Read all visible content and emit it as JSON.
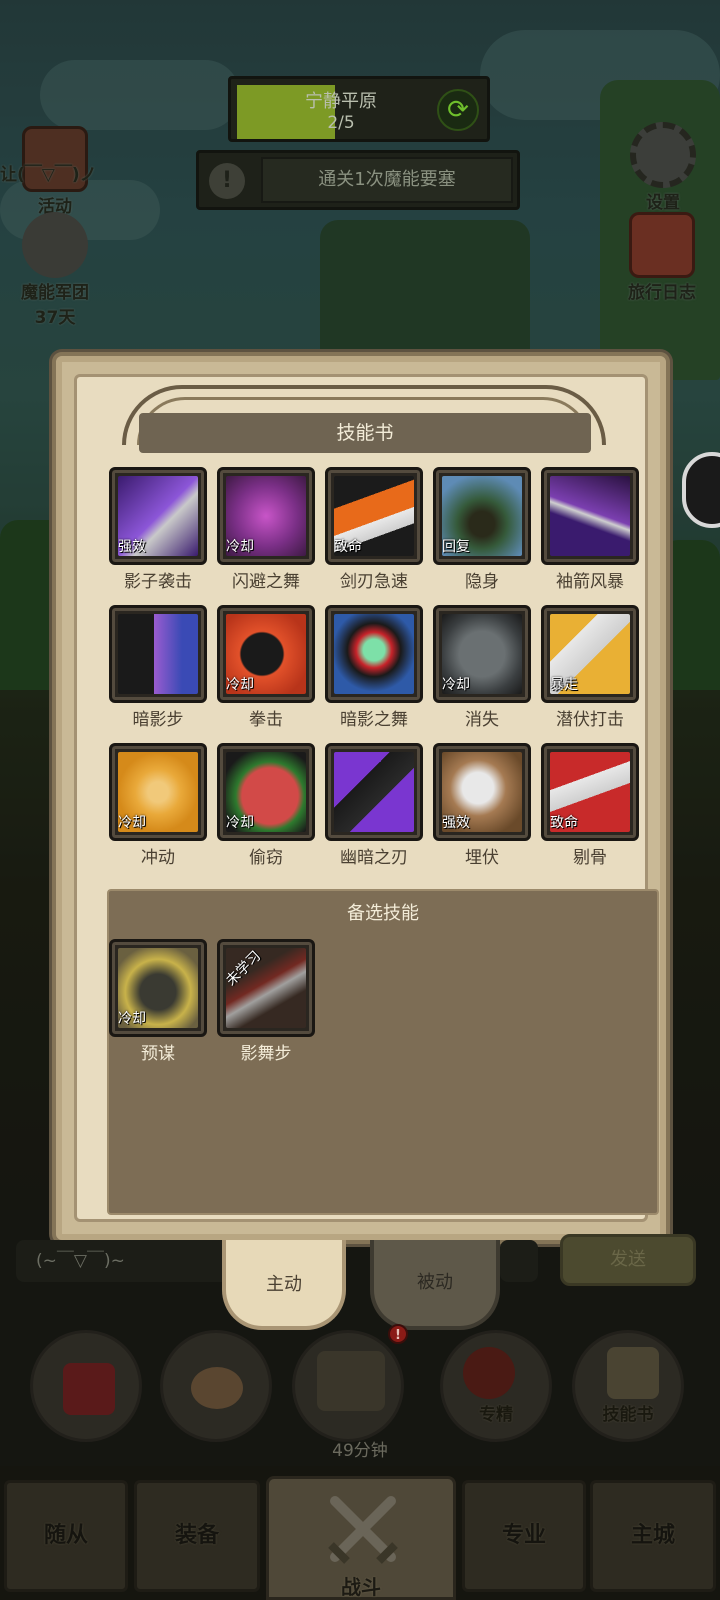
{
  "hud": {
    "stage_name": "宁静平原",
    "stage_progress": "2/5",
    "stage_progress_value": 0.4,
    "quest_text": "通关1次魔能要塞",
    "quest_alert_glyph": "!",
    "left_buttons": [
      {
        "label": "活动"
      },
      {
        "label": "魔能军团",
        "sub": "37天"
      }
    ],
    "right_buttons": [
      {
        "label": "设置"
      },
      {
        "label": "旅行日志"
      }
    ],
    "chat_emote_top": "让(￣▽￣)ノ"
  },
  "skill_book": {
    "title": "技能书",
    "skills": [
      {
        "name": "影子袭击",
        "tag": "强效",
        "icon": "shadow-strike-icon"
      },
      {
        "name": "闪避之舞",
        "tag": "冷却",
        "icon": "dodge-dance-icon"
      },
      {
        "name": "剑刃急速",
        "tag": "致命",
        "icon": "blade-rush-icon"
      },
      {
        "name": "隐身",
        "tag": "回复",
        "icon": "stealth-icon"
      },
      {
        "name": "袖箭风暴",
        "tag": "",
        "icon": "dart-storm-icon"
      },
      {
        "name": "暗影步",
        "tag": "",
        "icon": "shadow-step-icon"
      },
      {
        "name": "拳击",
        "tag": "冷却",
        "icon": "punch-icon"
      },
      {
        "name": "暗影之舞",
        "tag": "",
        "icon": "shadow-dance-icon"
      },
      {
        "name": "消失",
        "tag": "冷却",
        "icon": "vanish-icon"
      },
      {
        "name": "潜伏打击",
        "tag": "暴走",
        "icon": "ambush-strike-icon"
      },
      {
        "name": "冲动",
        "tag": "冷却",
        "icon": "impulse-icon"
      },
      {
        "name": "偷窃",
        "tag": "冷却",
        "icon": "steal-icon"
      },
      {
        "name": "幽暗之刃",
        "tag": "",
        "icon": "dark-blade-icon"
      },
      {
        "name": "埋伏",
        "tag": "强效",
        "icon": "ambush-icon"
      },
      {
        "name": "剔骨",
        "tag": "致命",
        "icon": "bone-cut-icon"
      }
    ],
    "alt_title": "备选技能",
    "alt_skills": [
      {
        "name": "预谋",
        "tag": "冷却",
        "icon": "premeditation-icon"
      },
      {
        "name": "影舞步",
        "tag": "未学习",
        "icon": "shadow-waltz-icon"
      }
    ]
  },
  "chat": {
    "input_text": "(~￣▽￣)~",
    "send_label": "发送"
  },
  "tabs": {
    "active": "主动",
    "inactive": "被动"
  },
  "actions": {
    "timer": "49分钟",
    "badge": "!",
    "specialize": "专精",
    "skillbook": "技能书"
  },
  "nav": {
    "followers": "随从",
    "equipment": "装备",
    "battle": "战斗",
    "profession": "专业",
    "main_city": "主城"
  },
  "colors": {
    "panel_bg": "#e8dcc0",
    "alt_section_bg": "#7d6d55",
    "progress_fill": "#7d9a25",
    "tag_text": "#ffffff"
  }
}
